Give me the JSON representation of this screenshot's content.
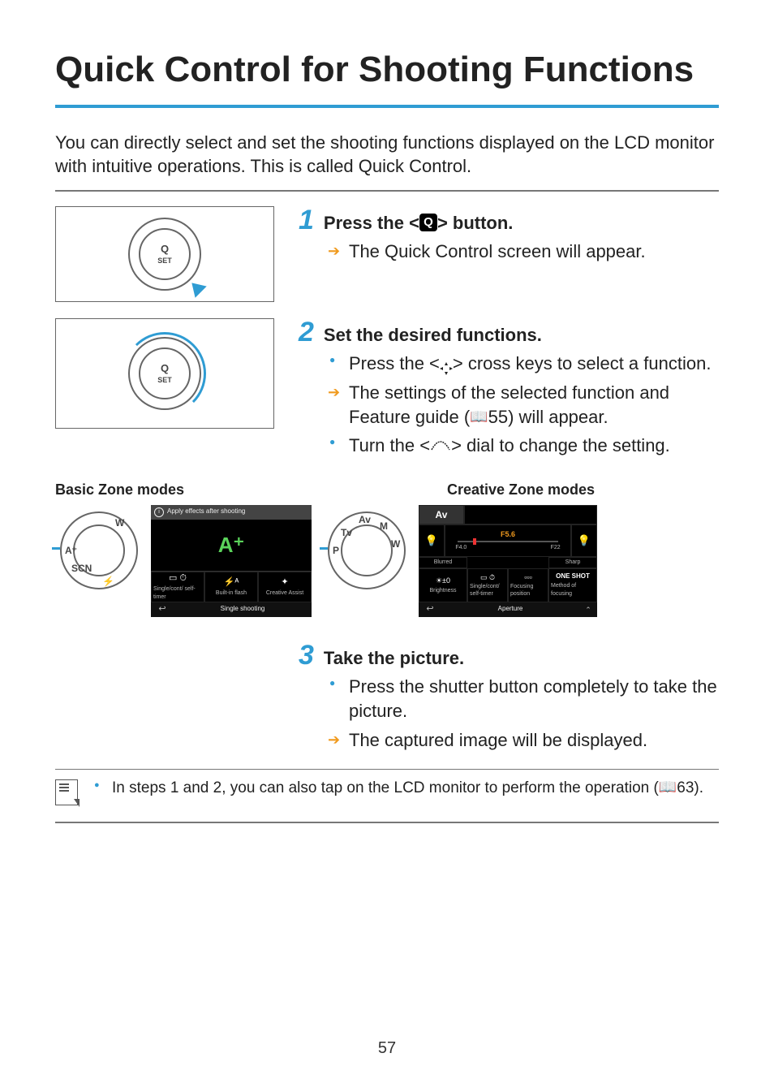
{
  "title": "Quick Control for Shooting Functions",
  "intro": "You can directly select and set the shooting functions displayed on the LCD monitor with intuitive operations. This is called Quick Control.",
  "steps": {
    "s1": {
      "num": "1",
      "title_pre": "Press the <",
      "title_post": "> button.",
      "q_label": "Q",
      "r1": "The Quick Control screen will appear."
    },
    "s2": {
      "num": "2",
      "title": "Set the desired functions.",
      "b1_pre": "Press the <",
      "b1_post": "> cross keys to select a function.",
      "r1_pre": "The settings of the selected function and Feature guide (",
      "r1_ref": "55",
      "r1_post": ") will appear.",
      "b2_pre": "Turn the <",
      "b2_post": "> dial to change the setting."
    },
    "s3": {
      "num": "3",
      "title": "Take the picture.",
      "b1": "Press the shutter button completely to take the picture.",
      "r1": "The captured image will be displayed."
    }
  },
  "zone_labels": {
    "basic": "Basic Zone modes",
    "creative": "Creative Zone modes"
  },
  "basic_dial": {
    "labels": [
      "A⁺",
      "SCN",
      "W",
      "⚡"
    ]
  },
  "creative_dial": {
    "labels": [
      "P",
      "Tv",
      "Av",
      "M",
      "W"
    ]
  },
  "lcd_basic": {
    "topbar": "Apply effects after shooting",
    "big": "A⁺",
    "cells": [
      {
        "icon": "▭ ⏱",
        "label": "Single/cont/ self-timer"
      },
      {
        "icon": "⚡ᴬ",
        "label": "Built-in flash"
      },
      {
        "icon": "✦",
        "label": "Creative Assist"
      }
    ],
    "foot_icon": "↩",
    "foot_label": "Single shooting"
  },
  "lcd_creative": {
    "mode": "Av",
    "fvalue": "F5.6",
    "fmin": "F4.0",
    "fmax": "F22",
    "left_icon": "💡",
    "right_icon": "💡",
    "row2_left": "Blurred",
    "row2_right": "Sharp",
    "row3a": {
      "icon": "☀±0",
      "label": "Brightness"
    },
    "row3b": {
      "icon": "▭ ⏱",
      "label": "Single/cont/ self-timer"
    },
    "row3c": {
      "icon": "▫▫▫",
      "label": "Focusing position"
    },
    "row3d": {
      "icon": "ONE SHOT",
      "label": "Method of focusing"
    },
    "foot_icon": "↩",
    "foot_label": "Aperture",
    "foot_arrow": "⌃"
  },
  "note": {
    "text_pre": "In steps 1 and 2, you can also tap on the LCD monitor to perform the operation (",
    "ref": "63",
    "text_post": ")."
  },
  "page_number": "57",
  "dial_center": {
    "q": "Q",
    "set": "SET"
  }
}
